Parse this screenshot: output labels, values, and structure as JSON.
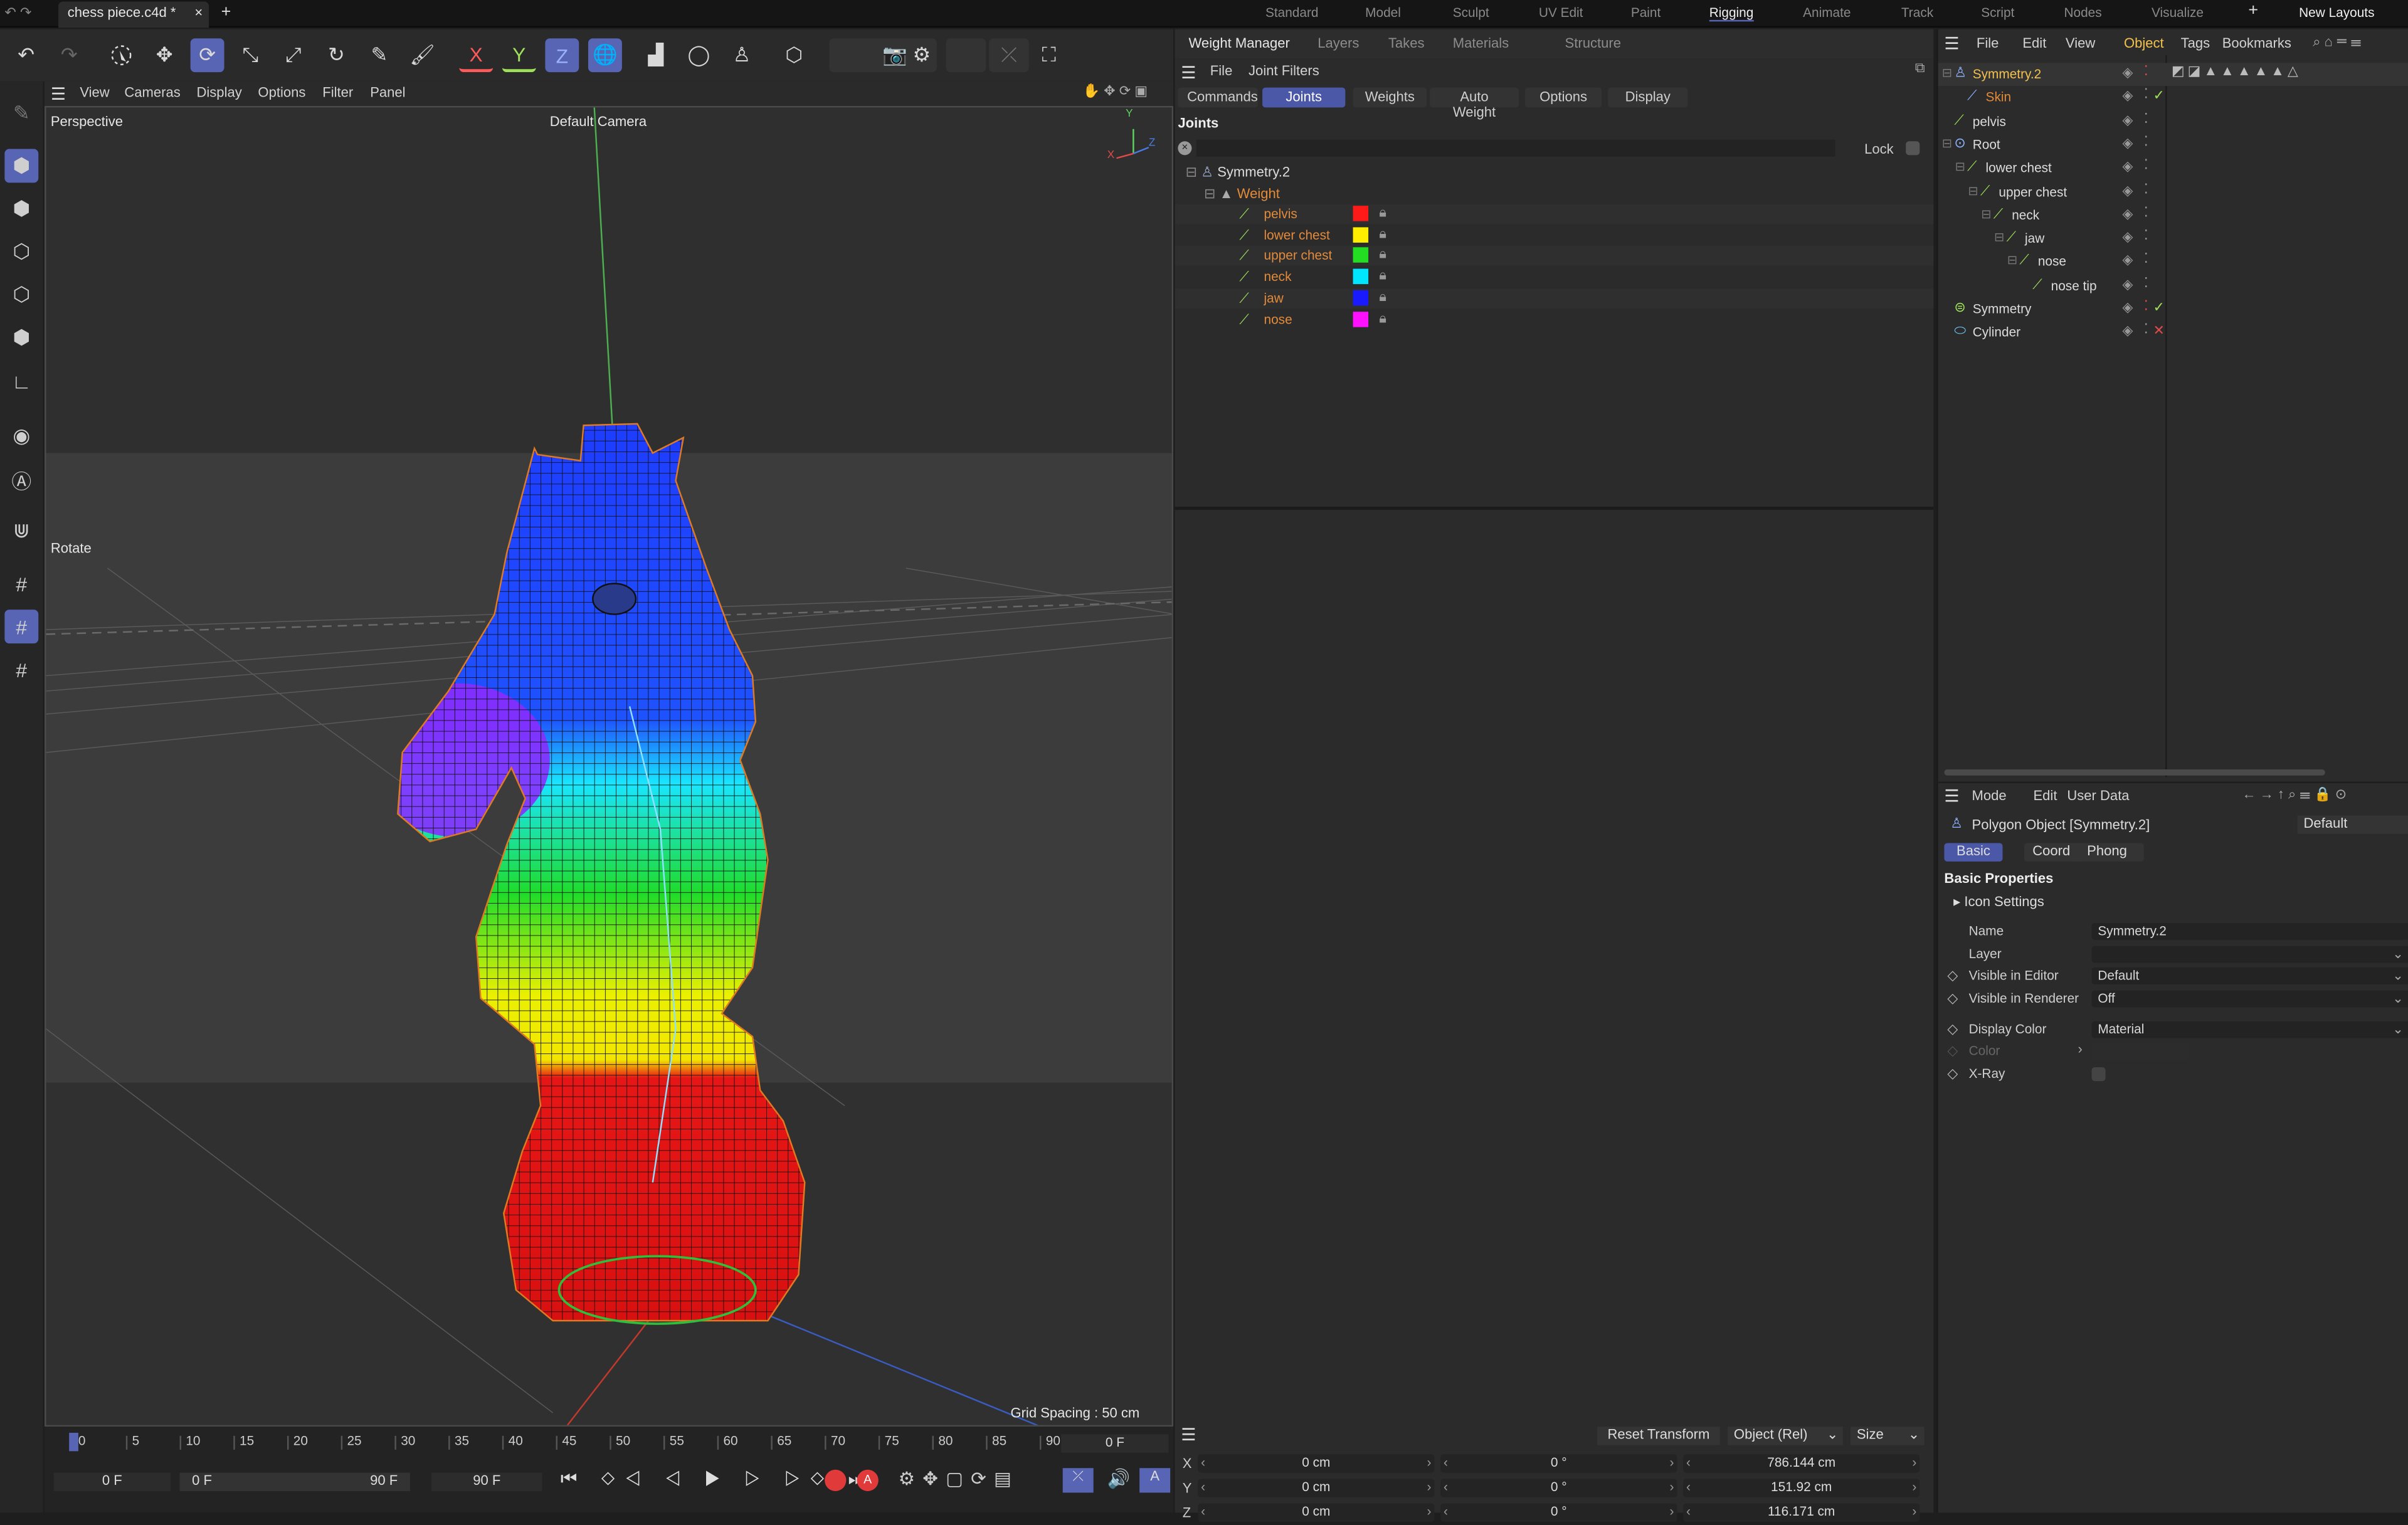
{
  "titlebar": {
    "doc_tab": "chess piece.c4d *",
    "close": "×",
    "add": "+",
    "layouts": [
      "Standard",
      "Model",
      "Sculpt",
      "UV Edit",
      "Paint",
      "Rigging",
      "Animate",
      "Track",
      "Script",
      "Nodes",
      "Visualize"
    ],
    "active_layout": "Rigging",
    "new_layouts": "New Layouts"
  },
  "toolbar": {
    "x": "X",
    "y": "Y",
    "z": "Z"
  },
  "viewport": {
    "menu": [
      "View",
      "Cameras",
      "Display",
      "Options",
      "Filter",
      "Panel"
    ],
    "label": "Perspective",
    "camera": "Default Camera",
    "rotate": "Rotate",
    "grid": "Grid Spacing : 50 cm",
    "axis_y": "Y",
    "axis_x": "X",
    "axis_z": "Z"
  },
  "timeline": {
    "ticks": [
      "0",
      "5",
      "10",
      "15",
      "20",
      "25",
      "30",
      "35",
      "40",
      "45",
      "50",
      "55",
      "60",
      "65",
      "70",
      "75",
      "80",
      "85",
      "90"
    ],
    "current": "0 F",
    "start": "0 F",
    "range_start": "0 F",
    "range_end": "90 F",
    "end": "90 F"
  },
  "weight_manager": {
    "tabs": [
      "Weight Manager",
      "Layers",
      "Takes",
      "Materials",
      "Structure"
    ],
    "menu": [
      "File",
      "Joint Filters"
    ],
    "subtabs": [
      "Commands",
      "Joints",
      "Weights",
      "Auto Weight",
      "Options",
      "Display"
    ],
    "active_subtab": "Joints",
    "section": "Joints",
    "lock": "Lock",
    "root": "Symmetry.2",
    "tag": "Weight",
    "joints": [
      {
        "name": "pelvis",
        "color": "#ff1a1a"
      },
      {
        "name": "lower chest",
        "color": "#ffee00"
      },
      {
        "name": "upper chest",
        "color": "#22dd22"
      },
      {
        "name": "neck",
        "color": "#00e5ff"
      },
      {
        "name": "jaw",
        "color": "#1a1aff"
      },
      {
        "name": "nose",
        "color": "#ff10ff"
      }
    ]
  },
  "object_manager": {
    "menu": [
      "File",
      "Edit",
      "View",
      "Object",
      "Tags",
      "Bookmarks"
    ],
    "active_menu": "Object",
    "objects": [
      {
        "name": "Symmetry.2",
        "color": "#f2c14e"
      },
      {
        "name": "Skin",
        "color": "#e38b3a"
      },
      {
        "name": "pelvis",
        "color": "#dcdcdc"
      },
      {
        "name": "Root",
        "color": "#dcdcdc"
      },
      {
        "name": "lower chest",
        "color": "#dcdcdc"
      },
      {
        "name": "upper chest",
        "color": "#dcdcdc"
      },
      {
        "name": "neck",
        "color": "#dcdcdc"
      },
      {
        "name": "jaw",
        "color": "#dcdcdc"
      },
      {
        "name": "nose",
        "color": "#dcdcdc"
      },
      {
        "name": "nose tip",
        "color": "#dcdcdc"
      },
      {
        "name": "Symmetry",
        "color": "#dcdcdc"
      },
      {
        "name": "Cylinder",
        "color": "#dcdcdc"
      }
    ]
  },
  "attributes": {
    "menu": [
      "Mode",
      "Edit",
      "User Data"
    ],
    "object_type": "Polygon Object [Symmetry.2]",
    "preset": "Default",
    "tabs": [
      "Basic",
      "Coord.",
      "Phong"
    ],
    "active_tab": "Basic",
    "section": "Basic Properties",
    "icon_settings": "Icon Settings",
    "fields": [
      {
        "label": "Name",
        "value": "Symmetry.2"
      },
      {
        "label": "Layer",
        "value": ""
      },
      {
        "label": "Visible in Editor",
        "value": "Default"
      },
      {
        "label": "Visible in Renderer",
        "value": "Off"
      },
      {
        "label": "Display Color",
        "value": "Material"
      },
      {
        "label": "Color",
        "value": ""
      },
      {
        "label": "X-Ray",
        "value": ""
      }
    ]
  },
  "coordinates": {
    "reset": "Reset Transform",
    "mode": "Object (Rel)",
    "size": "Size",
    "rows": [
      {
        "axis": "X",
        "pos": "0 cm",
        "rot": "0 °",
        "size": "786.144 cm"
      },
      {
        "axis": "Y",
        "pos": "0 cm",
        "rot": "0 °",
        "size": "151.92 cm"
      },
      {
        "axis": "Z",
        "pos": "0 cm",
        "rot": "0 °",
        "size": "116.171 cm"
      }
    ]
  }
}
